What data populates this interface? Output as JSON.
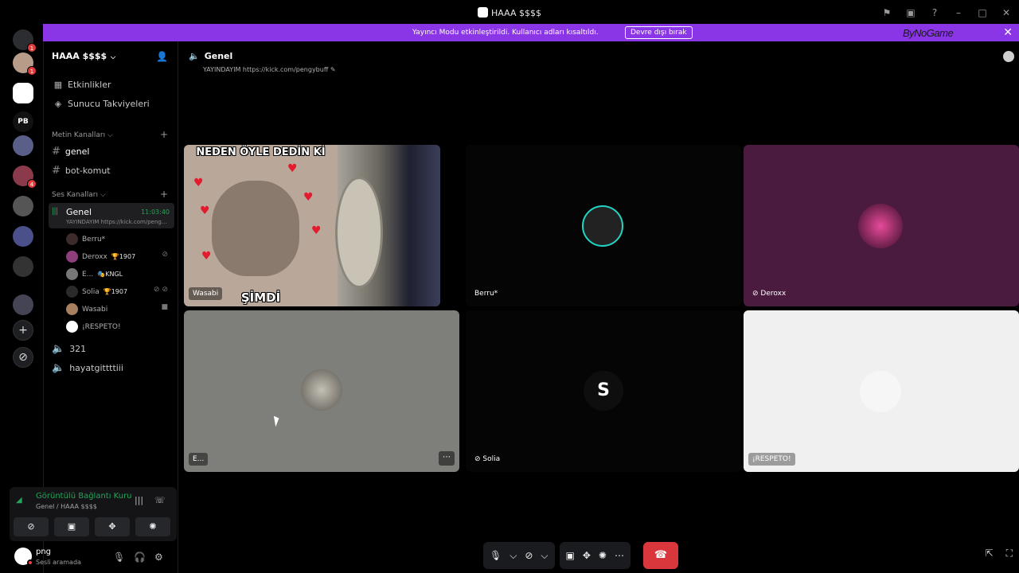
{
  "window": {
    "title": "HAAA $$$$"
  },
  "banner": {
    "text": "Yayıncı Modu etkinleştirildi. Kullanıcı adları kısaltıldı.",
    "button": "Devre dışı bırak",
    "brand": "ByNoGame"
  },
  "rail": {
    "badges": [
      "1",
      "1",
      "4"
    ],
    "server_labels": [
      "PB"
    ]
  },
  "sidebar": {
    "server_name": "HAAA $$$$",
    "nav": [
      {
        "label": "Etkinlikler",
        "icon": "calendar-icon"
      },
      {
        "label": "Sunucu Takviyeleri",
        "icon": "boost-icon"
      }
    ],
    "text_category": "Metin Kanalları",
    "text_channels": [
      "genel",
      "bot-komut"
    ],
    "voice_category": "Ses Kanalları",
    "active_voice": {
      "name": "Genel",
      "time": "11:03:40",
      "status": "YAYINDAYIM https://kick.com/peng..."
    },
    "voice_users": [
      {
        "name": "Berru*",
        "tag": "",
        "color": "#3d2a2a"
      },
      {
        "name": "Deroxx",
        "tag": "🏆1907",
        "color": "#8e3e7a"
      },
      {
        "name": "E...",
        "tag": "🎭KNGL",
        "color": "#777777"
      },
      {
        "name": "Solia",
        "tag": "🏆1907",
        "color": "#2a2a2a"
      },
      {
        "name": "Wasabi",
        "tag": "",
        "color": "#a88060"
      },
      {
        "name": "¡RESPETO!",
        "tag": "",
        "color": "#ffffff"
      }
    ],
    "other_voice": [
      "321",
      "hayatgittttiii"
    ]
  },
  "rtc": {
    "title": "Görüntülü Bağlantı Kuru",
    "subtitle": "Genel / HAAA $$$$"
  },
  "user": {
    "name": "png",
    "status": "Sesli aramada"
  },
  "main": {
    "channel": "Genel",
    "status": "YAYINDAYIM https://kick.com/pengybuff",
    "tiles": [
      {
        "label": "Wasabi",
        "meme_top": "NEDEN ÖYLE DEDİN Kİ",
        "meme_bottom": "ŞİMDİ"
      },
      {
        "label": "Berru*"
      },
      {
        "label": "Deroxx"
      },
      {
        "label": "E..."
      },
      {
        "label": "Solia",
        "letter": "S"
      },
      {
        "label": "¡RESPETO!"
      }
    ]
  },
  "colors": {
    "banner": "#8a35e6",
    "green": "#23a55a",
    "hangup": "#da373c",
    "deroxx_tile": "#4a1a3f",
    "e_tile": "#7e7e7b",
    "respeto_tile": "#f0f0f0"
  }
}
